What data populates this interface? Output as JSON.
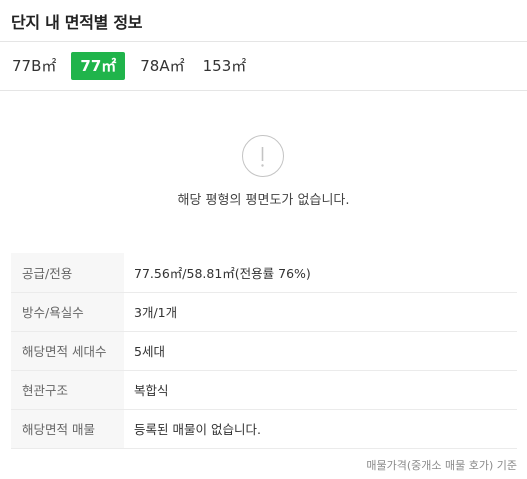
{
  "header": {
    "title": "단지 내 면적별 정보"
  },
  "tabs": [
    {
      "label": "77B㎡",
      "active": false
    },
    {
      "label": "77㎡",
      "active": true
    },
    {
      "label": "78A㎡",
      "active": false
    },
    {
      "label": "153㎡",
      "active": false
    }
  ],
  "floorplan": {
    "message": "해당 평형의 평면도가 없습니다."
  },
  "info": {
    "rows": [
      {
        "label": "공급/전용",
        "value": "77.56㎡/58.81㎡(전용률 76%)"
      },
      {
        "label": "방수/욕실수",
        "value": "3개/1개"
      },
      {
        "label": "해당면적 세대수",
        "value": "5세대"
      },
      {
        "label": "현관구조",
        "value": "복합식"
      },
      {
        "label": "해당면적 매물",
        "value": "등록된 매물이 없습니다."
      }
    ]
  },
  "footnote": "매물가격(중개소 매물 호가) 기준",
  "colors": {
    "accent": "#20b44b"
  }
}
